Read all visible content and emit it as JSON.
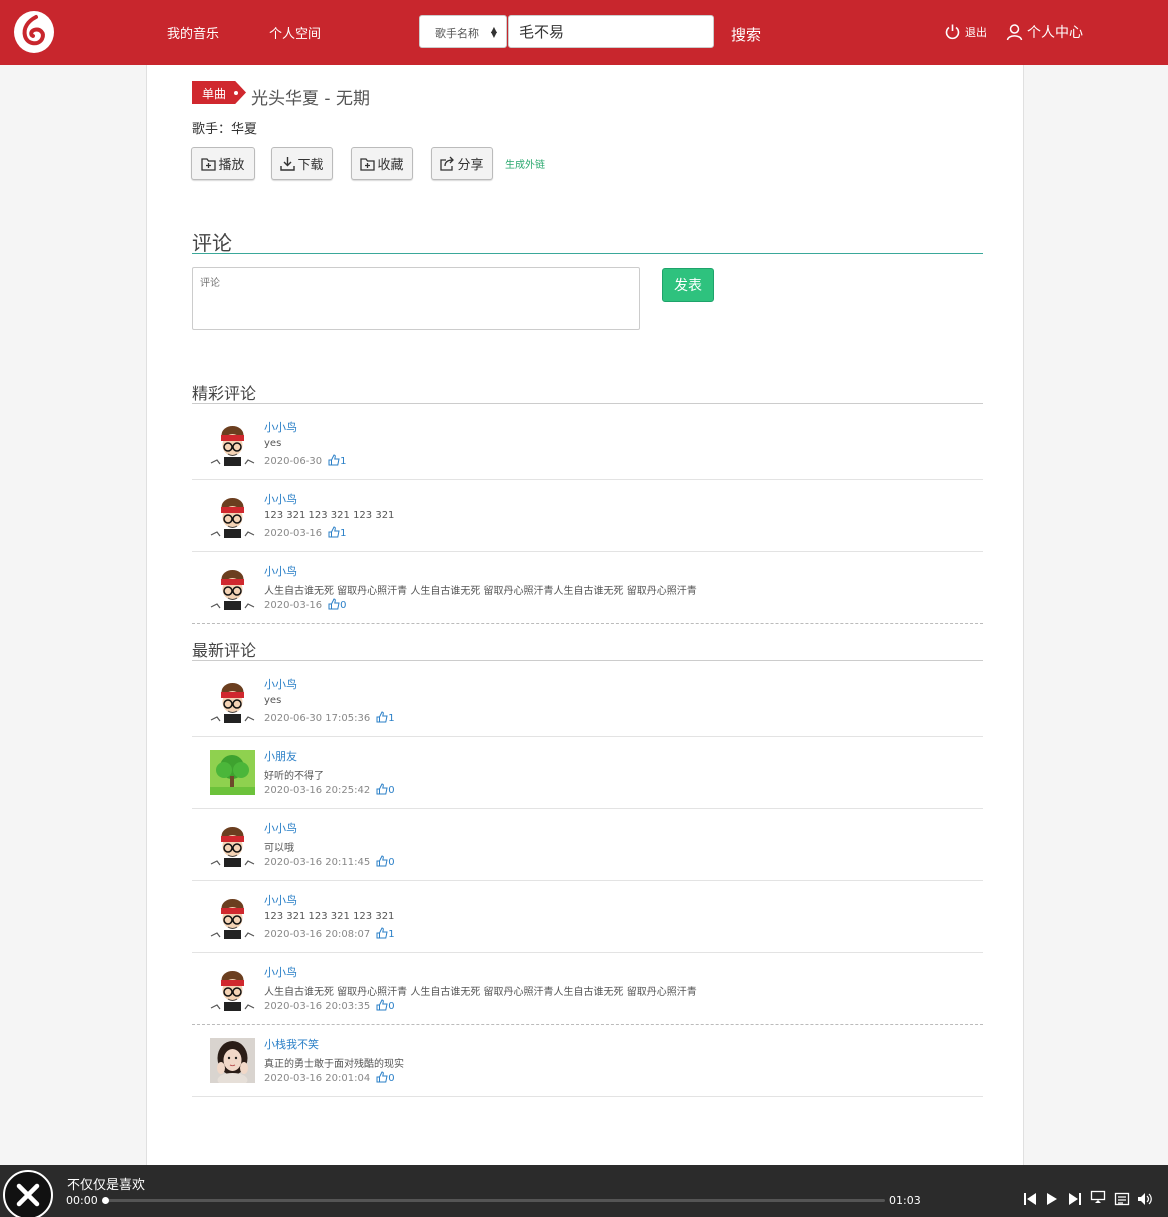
{
  "header": {
    "nav": [
      "我的音乐",
      "个人空间"
    ],
    "search_type": "歌手名称",
    "search_value": "毛不易",
    "search_button": "搜索",
    "logout": "退出",
    "user_center": "个人中心"
  },
  "song": {
    "badge": "单曲",
    "title": "光头华夏 - 无期",
    "singer": "歌手：华夏",
    "actions": [
      "播放",
      "下载",
      "收藏",
      "分享"
    ],
    "external_link": "生成外链"
  },
  "comment_section": {
    "title": "评论",
    "placeholder": "评论",
    "publish": "发表"
  },
  "hot_comments": {
    "title": "精彩评论",
    "items": [
      {
        "user": "小小鸟",
        "text": "yes",
        "time": "2020-06-30",
        "likes": "1",
        "avatar": "cartoon"
      },
      {
        "user": "小小鸟",
        "text": "123 321 123 321 123 321",
        "time": "2020-03-16",
        "likes": "1",
        "avatar": "cartoon"
      },
      {
        "user": "小小鸟",
        "text": "人生自古谁无死 留取丹心照汗青 人生自古谁无死 留取丹心照汗青人生自古谁无死 留取丹心照汗青",
        "time": "2020-03-16",
        "likes": "0",
        "avatar": "cartoon"
      }
    ]
  },
  "new_comments": {
    "title": "最新评论",
    "items": [
      {
        "user": "小小鸟",
        "text": "yes",
        "time": "2020-06-30 17:05:36",
        "likes": "1",
        "avatar": "cartoon"
      },
      {
        "user": "小朋友",
        "text": "好听的不得了",
        "time": "2020-03-16 20:25:42",
        "likes": "0",
        "avatar": "tree"
      },
      {
        "user": "小小鸟",
        "text": "可以哦",
        "time": "2020-03-16 20:11:45",
        "likes": "0",
        "avatar": "cartoon"
      },
      {
        "user": "小小鸟",
        "text": "123 321 123 321 123 321",
        "time": "2020-03-16 20:08:07",
        "likes": "1",
        "avatar": "cartoon"
      },
      {
        "user": "小小鸟",
        "text": "人生自古谁无死 留取丹心照汗青 人生自古谁无死 留取丹心照汗青人生自古谁无死 留取丹心照汗青",
        "time": "2020-03-16 20:03:35",
        "likes": "0",
        "avatar": "cartoon"
      },
      {
        "user": "小栈我不笑",
        "text": "真正的勇士敢于面对残酷的现实",
        "time": "2020-03-16 20:01:04",
        "likes": "0",
        "avatar": "girl"
      }
    ]
  },
  "player": {
    "track": "不仅仅是喜欢",
    "current_time": "00:00",
    "duration": "01:03",
    "progress": 0
  },
  "colors": {
    "header": "#c8262d",
    "accent_green": "#2ec27e",
    "link_blue": "#2a7fc7",
    "player_bg": "#2b2b2b"
  }
}
